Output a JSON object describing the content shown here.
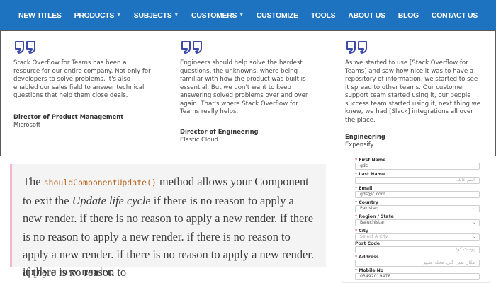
{
  "nav": {
    "items": [
      {
        "label": "NEW TITLES",
        "dropdown": false
      },
      {
        "label": "PRODUCTS",
        "dropdown": true
      },
      {
        "label": "SUBJECTS",
        "dropdown": true
      },
      {
        "label": "CUSTOMERS",
        "dropdown": true
      },
      {
        "label": "CUSTOMIZE",
        "dropdown": false
      },
      {
        "label": "TOOLS",
        "dropdown": false
      },
      {
        "label": "ABOUT US",
        "dropdown": false
      },
      {
        "label": "BLOG",
        "dropdown": false
      },
      {
        "label": "CONTACT US",
        "dropdown": false
      }
    ],
    "background": "#1e73c0"
  },
  "testimonials": [
    {
      "quote": "Stack Overflow for Teams has been a resource for our entire company. Not only for developers to solve problems, it's also enabled our sales field to answer technical questions that help them close deals.",
      "role": "Director of Product Management",
      "company": "Microsoft"
    },
    {
      "quote": "Engineers should help solve the hardest questions, the unknowns, where being familiar with how the product was built is essential. But we don't want to keep answering solved problems over and over again. That's where Stack Overflow for Teams really helps.",
      "role": "Director of Engineering",
      "company": "Elastic Cloud"
    },
    {
      "quote": "As we started to use [Stack Overflow for Teams] and saw how nice it was to have a repository of information, we started to see it spread to other teams. Our customer support team started using it, our people success team started using it, next thing we knew, we had [Slack] integrations all over the place.",
      "role": "Engineering",
      "company": "Expensify"
    }
  ],
  "quote_icon_color": "#3b4aa8",
  "snippet": {
    "intro": "The ",
    "code": "shouldComponentUpdate()",
    "mid": " method allows your Component to exit the ",
    "emphasis": "Update life cycle",
    "rest": " if there is no reason to apply a new render. if there is no reason to apply a new render. if there is no reason to apply a new render. if there is no reason to apply a new render. if there is no reason to apply a new render. if there is no reason to",
    "tail": "apply a new render."
  },
  "form": {
    "fields": [
      {
        "label": "First Name",
        "value": "gds",
        "placeholder": false,
        "dropdown": false
      },
      {
        "label": "Last Name",
        "value": "اسم عائلہ",
        "placeholder": true,
        "dropdown": false
      },
      {
        "label": "Email",
        "value": "gds@c.com",
        "placeholder": false,
        "dropdown": false
      },
      {
        "label": "Country",
        "value": "Pakistan",
        "placeholder": false,
        "dropdown": true
      },
      {
        "label": "Region / State",
        "value": "Baluchistan",
        "placeholder": false,
        "dropdown": true
      },
      {
        "label": "City",
        "value": "Select A City",
        "placeholder": true,
        "dropdown": true
      },
      {
        "label": "Post Code",
        "value": "پوسٹ کوڈ",
        "placeholder": true,
        "dropdown": false,
        "required": false
      },
      {
        "label": "Address",
        "value": "مکان نمبر، گلی، محلہ، شہر",
        "placeholder": true,
        "dropdown": false
      },
      {
        "label": "Mobile No",
        "value": "03492019478",
        "placeholder": false,
        "dropdown": false
      }
    ]
  }
}
